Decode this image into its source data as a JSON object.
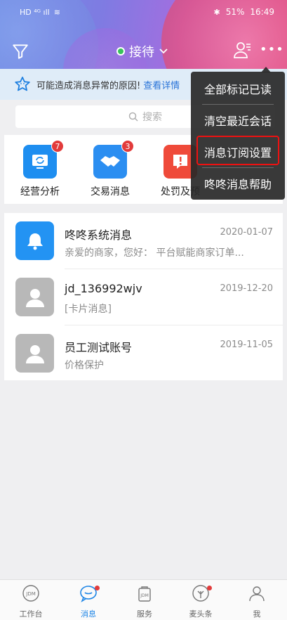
{
  "status_bar": {
    "left_icons": "HD ⁴ᴳ ıll",
    "battery": "51%",
    "time": "16:49"
  },
  "header": {
    "status_label": "接待"
  },
  "notice": {
    "text": "可能造成消息异常的原因!",
    "link": "查看详情"
  },
  "search": {
    "placeholder": "搜索"
  },
  "quick_actions": [
    {
      "label": "经营分析",
      "badge": "7",
      "color": "#1e8ef0",
      "icon": "refresh-screen-icon"
    },
    {
      "label": "交易消息",
      "badge": "3",
      "color": "#2b8ef1",
      "icon": "handshake-icon"
    },
    {
      "label": "处罚及预",
      "badge": "",
      "color": "#ef4a3a",
      "icon": "alert-icon"
    }
  ],
  "messages": [
    {
      "title": "咚咚系统消息",
      "date": "2020-01-07",
      "preview": "亲爱的商家，您好： 平台赋能商家订单...",
      "avatar": "bell-icon"
    },
    {
      "title": "jd_136992wjv",
      "date": "2019-12-20",
      "preview": "[卡片消息]",
      "avatar": "user-icon"
    },
    {
      "title": "员工测试账号",
      "date": "2019-11-05",
      "preview": "价格保护",
      "avatar": "user-icon"
    }
  ],
  "menu": {
    "items": [
      "全部标记已读",
      "清空最近会话",
      "消息订阅设置",
      "咚咚消息帮助"
    ]
  },
  "tabs": [
    {
      "label": "工作台",
      "icon": "jdm-workbench-icon"
    },
    {
      "label": "消息",
      "icon": "message-icon"
    },
    {
      "label": "服务",
      "icon": "service-bag-icon"
    },
    {
      "label": "麦头条",
      "icon": "headlines-icon"
    },
    {
      "label": "我",
      "icon": "profile-icon"
    }
  ]
}
